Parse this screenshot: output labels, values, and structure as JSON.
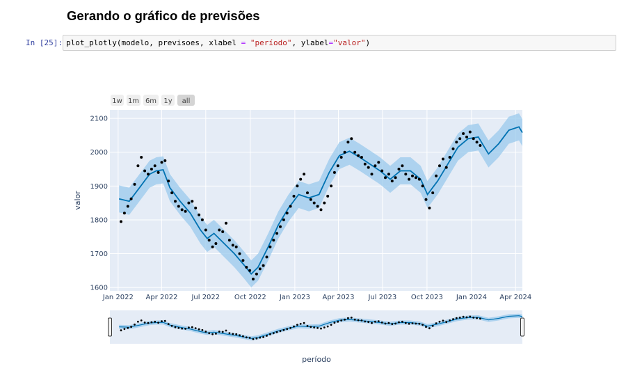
{
  "notebook": {
    "heading": "Gerando o gráfico de previsões",
    "prompt": "In [25]:",
    "code": {
      "prefix": "plot_plotly(modelo, previsoes, xlabel ",
      "eq1": "=",
      "mid1": " ",
      "str1": "\"período\"",
      "mid2": ", ylabel",
      "eq2": "=",
      "str2": "\"valor\"",
      "suffix": ")"
    }
  },
  "rangeselector": {
    "buttons": [
      "1w",
      "1m",
      "6m",
      "1y",
      "all"
    ],
    "active": "all"
  },
  "colors": {
    "plot_bg": "#e5ecf6",
    "band": "#9ac9ec",
    "line": "#0072b2",
    "points": "#000000",
    "button": "#eeeeee",
    "button_active": "#d4d4d4"
  },
  "chart_data": {
    "type": "line",
    "xlabel": "período",
    "ylabel": "valor",
    "x_range": [
      "2021-12-15",
      "2024-04-15"
    ],
    "ylim": [
      1590,
      2125
    ],
    "x_ticks": [
      "Jan 2022",
      "Apr 2022",
      "Jul 2022",
      "Oct 2022",
      "Jan 2023",
      "Apr 2023",
      "Jul 2023",
      "Oct 2023",
      "Jan 2024",
      "Apr 2024"
    ],
    "y_ticks": [
      1600,
      1700,
      1800,
      1900,
      2000,
      2100
    ],
    "series": [
      {
        "name": "",
        "kind": "forecast (yhat) with uncertainty band",
        "x": [
          "2022-01-03",
          "2022-01-24",
          "2022-02-14",
          "2022-03-07",
          "2022-03-21",
          "2022-04-04",
          "2022-04-18",
          "2022-05-09",
          "2022-05-30",
          "2022-06-20",
          "2022-07-04",
          "2022-07-18",
          "2022-08-08",
          "2022-08-29",
          "2022-09-19",
          "2022-10-03",
          "2022-10-17",
          "2022-11-07",
          "2022-11-28",
          "2022-12-19",
          "2023-01-09",
          "2023-01-30",
          "2023-02-20",
          "2023-03-13",
          "2023-04-03",
          "2023-04-24",
          "2023-05-15",
          "2023-06-05",
          "2023-06-26",
          "2023-07-17",
          "2023-08-07",
          "2023-08-28",
          "2023-09-18",
          "2023-10-02",
          "2023-10-23",
          "2023-11-13",
          "2023-12-04",
          "2023-12-25",
          "2024-01-15",
          "2024-02-05",
          "2024-02-26",
          "2024-03-18",
          "2024-04-08",
          "2024-04-15"
        ],
        "y": [
          1862,
          1855,
          1895,
          1935,
          1945,
          1948,
          1895,
          1855,
          1820,
          1770,
          1745,
          1760,
          1730,
          1700,
          1665,
          1640,
          1660,
          1720,
          1785,
          1835,
          1875,
          1865,
          1875,
          1940,
          1990,
          2003,
          1985,
          1965,
          1945,
          1920,
          1945,
          1945,
          1920,
          1875,
          1915,
          1965,
          2015,
          2040,
          2045,
          1995,
          2025,
          2065,
          2075,
          2058
        ],
        "upper": [
          1902,
          1895,
          1935,
          1975,
          1985,
          1988,
          1935,
          1895,
          1860,
          1810,
          1785,
          1800,
          1770,
          1740,
          1705,
          1680,
          1700,
          1760,
          1825,
          1875,
          1915,
          1905,
          1915,
          1980,
          2030,
          2043,
          2025,
          2005,
          1985,
          1960,
          1985,
          1985,
          1960,
          1915,
          1955,
          2005,
          2055,
          2080,
          2085,
          2035,
          2065,
          2105,
          2115,
          2098
        ],
        "lower": [
          1822,
          1815,
          1855,
          1895,
          1905,
          1908,
          1855,
          1815,
          1780,
          1730,
          1705,
          1720,
          1690,
          1660,
          1625,
          1600,
          1620,
          1680,
          1745,
          1795,
          1835,
          1825,
          1835,
          1900,
          1950,
          1963,
          1945,
          1925,
          1905,
          1880,
          1905,
          1905,
          1880,
          1835,
          1875,
          1925,
          1975,
          2000,
          2005,
          1955,
          1985,
          2025,
          2035,
          2018
        ]
      },
      {
        "name": "",
        "kind": "observed points (approximate)",
        "x": [
          "2022-01-07",
          "2022-01-14",
          "2022-01-21",
          "2022-01-28",
          "2022-02-04",
          "2022-02-11",
          "2022-02-18",
          "2022-02-25",
          "2022-03-04",
          "2022-03-11",
          "2022-03-18",
          "2022-03-25",
          "2022-04-01",
          "2022-04-08",
          "2022-04-15",
          "2022-04-22",
          "2022-04-29",
          "2022-05-06",
          "2022-05-13",
          "2022-05-20",
          "2022-05-27",
          "2022-06-03",
          "2022-06-10",
          "2022-06-17",
          "2022-06-24",
          "2022-07-01",
          "2022-07-08",
          "2022-07-15",
          "2022-07-22",
          "2022-07-29",
          "2022-08-05",
          "2022-08-12",
          "2022-08-19",
          "2022-08-26",
          "2022-09-02",
          "2022-09-09",
          "2022-09-16",
          "2022-09-23",
          "2022-09-30",
          "2022-10-07",
          "2022-10-14",
          "2022-10-21",
          "2022-10-28",
          "2022-11-04",
          "2022-11-11",
          "2022-11-18",
          "2022-11-25",
          "2022-12-02",
          "2022-12-09",
          "2022-12-16",
          "2022-12-23",
          "2022-12-30",
          "2023-01-06",
          "2023-01-13",
          "2023-01-20",
          "2023-01-27",
          "2023-02-03",
          "2023-02-10",
          "2023-02-17",
          "2023-02-24",
          "2023-03-03",
          "2023-03-10",
          "2023-03-17",
          "2023-03-24",
          "2023-03-31",
          "2023-04-07",
          "2023-04-14",
          "2023-04-21",
          "2023-04-28",
          "2023-05-05",
          "2023-05-12",
          "2023-05-19",
          "2023-05-26",
          "2023-06-02",
          "2023-06-09",
          "2023-06-16",
          "2023-06-23",
          "2023-06-30",
          "2023-07-07",
          "2023-07-14",
          "2023-07-21",
          "2023-07-28",
          "2023-08-04",
          "2023-08-11",
          "2023-08-18",
          "2023-08-25",
          "2023-09-01",
          "2023-09-08",
          "2023-09-15",
          "2023-09-22",
          "2023-09-29",
          "2023-10-06",
          "2023-10-13",
          "2023-10-20",
          "2023-10-27",
          "2023-11-03",
          "2023-11-10",
          "2023-11-17",
          "2023-11-24",
          "2023-12-01",
          "2023-12-08",
          "2023-12-15",
          "2023-12-22",
          "2023-12-29",
          "2024-01-05",
          "2024-01-12",
          "2024-01-19"
        ],
        "y": [
          1795,
          1820,
          1840,
          1862,
          1905,
          1960,
          1985,
          1945,
          1935,
          1950,
          1960,
          1940,
          1970,
          1975,
          1915,
          1880,
          1855,
          1840,
          1830,
          1825,
          1850,
          1855,
          1835,
          1815,
          1800,
          1770,
          1740,
          1720,
          1730,
          1770,
          1765,
          1790,
          1740,
          1725,
          1720,
          1700,
          1680,
          1660,
          1650,
          1625,
          1640,
          1655,
          1665,
          1690,
          1720,
          1740,
          1760,
          1780,
          1800,
          1820,
          1840,
          1870,
          1900,
          1920,
          1935,
          1880,
          1860,
          1850,
          1840,
          1830,
          1850,
          1870,
          1900,
          1940,
          1960,
          1985,
          2000,
          2030,
          2040,
          2000,
          1990,
          1985,
          1965,
          1955,
          1935,
          1960,
          1970,
          1945,
          1925,
          1935,
          1915,
          1925,
          1950,
          1960,
          1935,
          1920,
          1930,
          1925,
          1920,
          1900,
          1860,
          1835,
          1880,
          1930,
          1960,
          1980,
          1955,
          1985,
          2010,
          2030,
          2040,
          2055,
          2045,
          2060,
          2040,
          2030,
          2020
        ]
      }
    ],
    "grid": true,
    "legend": "none"
  }
}
